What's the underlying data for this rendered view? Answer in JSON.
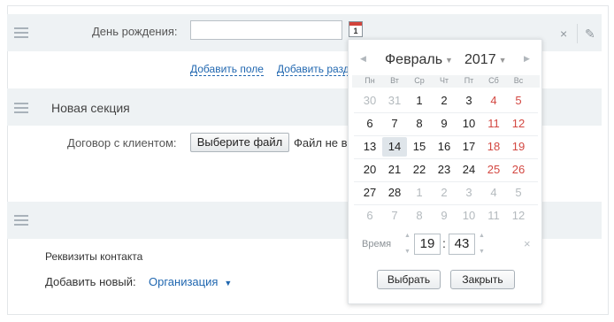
{
  "form": {
    "birthday_label": "День рождения:",
    "birthday_value": "",
    "calendar_icon_text": "1",
    "add_field_link": "Добавить поле",
    "add_section_link": "Добавить разд",
    "close_glyph": "×",
    "edit_glyph": "✎",
    "new_section_title": "Новая секция",
    "contract_label": "Договор с клиентом:",
    "choose_file_button": "Выберите файл",
    "no_file_text": "Файл не в",
    "contact_details_label": "Реквизиты контакта",
    "add_new_label": "Добавить новый:",
    "add_new_value": "Организация"
  },
  "calendar": {
    "month": "Февраль",
    "year": "2017",
    "weekdays": [
      "Пн",
      "Вт",
      "Ср",
      "Чт",
      "Пт",
      "Сб",
      "Вс"
    ],
    "weeks": [
      [
        "30",
        "31",
        "1",
        "2",
        "3",
        "4",
        "5"
      ],
      [
        "6",
        "7",
        "8",
        "9",
        "10",
        "11",
        "12"
      ],
      [
        "13",
        "14",
        "15",
        "16",
        "17",
        "18",
        "19"
      ],
      [
        "20",
        "21",
        "22",
        "23",
        "24",
        "25",
        "26"
      ],
      [
        "27",
        "28",
        "1",
        "2",
        "3",
        "4",
        "5"
      ],
      [
        "6",
        "7",
        "8",
        "9",
        "10",
        "11",
        "12"
      ]
    ],
    "other_month": [
      [
        true,
        true,
        false,
        false,
        false,
        false,
        false
      ],
      [
        false,
        false,
        false,
        false,
        false,
        false,
        false
      ],
      [
        false,
        false,
        false,
        false,
        false,
        false,
        false
      ],
      [
        false,
        false,
        false,
        false,
        false,
        false,
        false
      ],
      [
        false,
        false,
        true,
        true,
        true,
        true,
        true
      ],
      [
        true,
        true,
        true,
        true,
        true,
        true,
        true
      ]
    ],
    "today": "14",
    "time_label": "Время",
    "hours": "19",
    "minutes": "43",
    "select_button": "Выбрать",
    "close_button": "Закрыть",
    "colors": {
      "weekend": "#d34842",
      "other_month": "#b4babe",
      "today_bg": "#dfe5ea",
      "link": "#2067b0"
    }
  }
}
